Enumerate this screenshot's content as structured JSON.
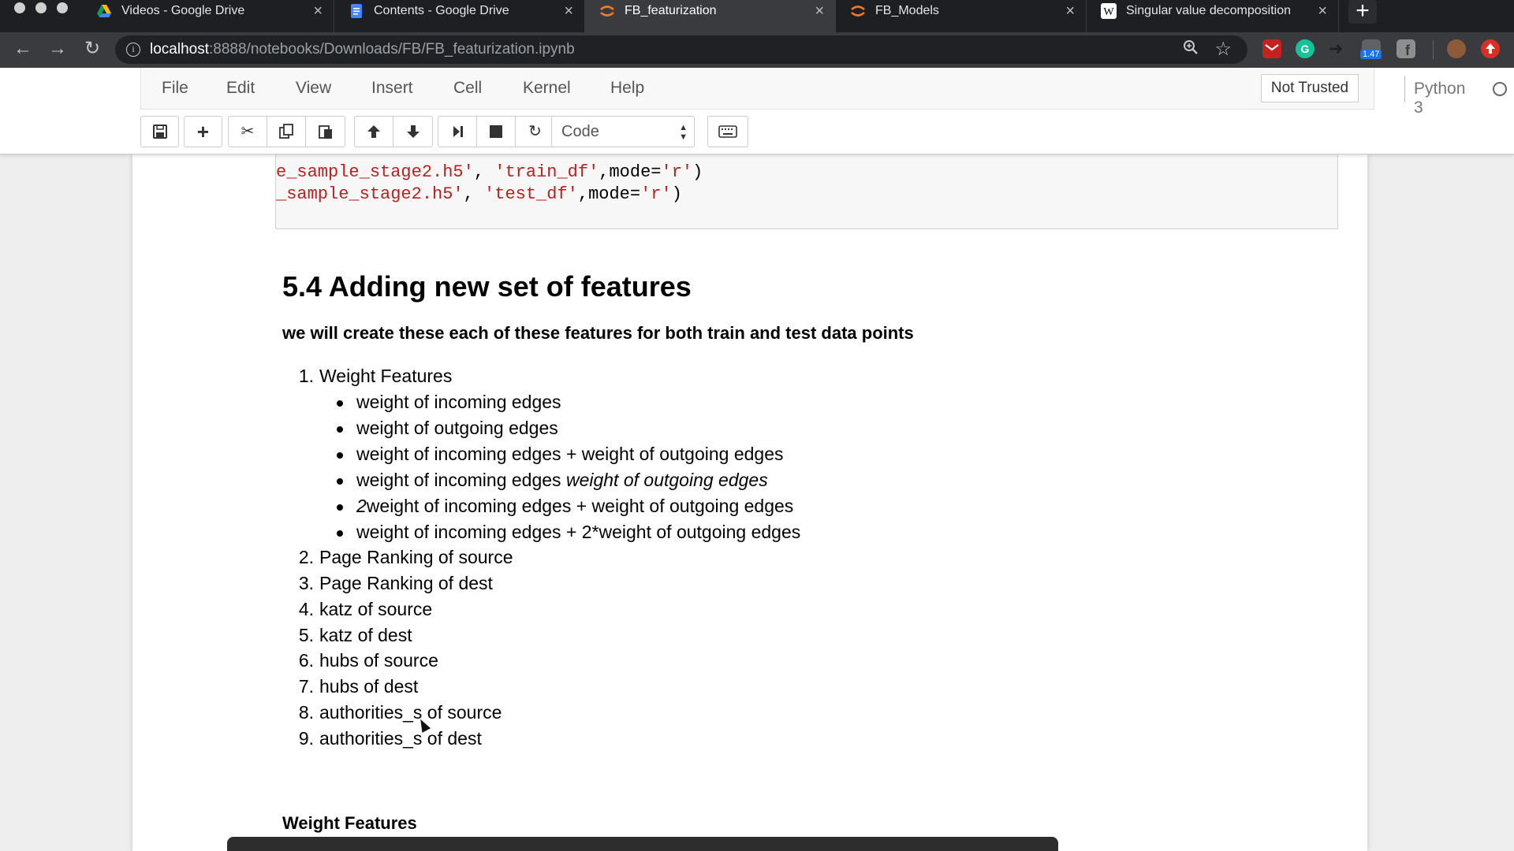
{
  "browser": {
    "tabs": [
      {
        "title": "Videos - Google Drive",
        "icon": "google-drive-icon",
        "active": false
      },
      {
        "title": "Contents - Google Drive",
        "icon": "google-docs-icon",
        "active": false
      },
      {
        "title": "FB_featurization",
        "icon": "jupyter-icon",
        "active": true
      },
      {
        "title": "FB_Models",
        "icon": "jupyter-icon",
        "active": false
      },
      {
        "title": "Singular value decomposition",
        "icon": "wikipedia-icon",
        "active": false
      }
    ],
    "close_glyph": "×",
    "new_tab_glyph": "+",
    "url_host": "localhost",
    "url_path": ":8888/notebooks/Downloads/FB/FB_featurization.ipynb",
    "extension_badge": "1.47"
  },
  "jupyter": {
    "menu": [
      "File",
      "Edit",
      "View",
      "Insert",
      "Cell",
      "Kernel",
      "Help"
    ],
    "trust_label": "Not Trusted",
    "kernel_name": "Python 3",
    "cell_type": "Code"
  },
  "notebook": {
    "code_lines": [
      {
        "pre": "e_sample_stage2.h5'",
        "sep": ", ",
        "arg": "'train_df'",
        "mid": ",mode=",
        "mode": "'r'",
        "end": ")"
      },
      {
        "pre": "_sample_stage2.h5'",
        "sep": ", ",
        "arg": "'test_df'",
        "mid": ",mode=",
        "mode": "'r'",
        "end": ")"
      }
    ],
    "heading": "5.4 Adding new set of features",
    "lead": "we will create these each of these features for both train and test data points",
    "items": [
      {
        "num": "1.",
        "text": "Weight Features"
      },
      {
        "num": "2.",
        "text": "Page Ranking of source"
      },
      {
        "num": "3.",
        "text": "Page Ranking of dest"
      },
      {
        "num": "4.",
        "text": "katz of source"
      },
      {
        "num": "5.",
        "text": "katz of dest"
      },
      {
        "num": "6.",
        "text": "hubs of source"
      },
      {
        "num": "7.",
        "text": "hubs of dest"
      },
      {
        "num": "8.",
        "text": "authorities_s of source"
      },
      {
        "num": "9.",
        "text": "authorities_s of dest"
      }
    ],
    "weight_subitems": [
      "weight of incoming edges",
      "weight of outgoing edges",
      "weight of incoming edges + weight of outgoing edges",
      "weight of incoming edges",
      "weight of outgoing edges",
      "2",
      "weight of incoming edges + weight of outgoing edges",
      "weight of incoming edges + 2*weight of outgoing edges"
    ],
    "subheading": "Weight Features"
  }
}
